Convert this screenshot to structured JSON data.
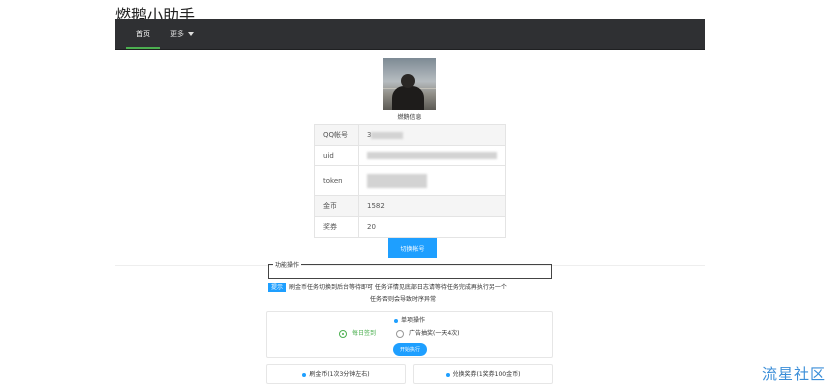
{
  "app": {
    "title": "燃鹅小助手"
  },
  "nav": {
    "home": "首页",
    "more": "更多"
  },
  "profile": {
    "caption": "燃鹅信息"
  },
  "account_table": {
    "rows": [
      {
        "label": "QQ帐号",
        "value": "3"
      },
      {
        "label": "uid",
        "value": ""
      },
      {
        "label": "token",
        "value": ""
      },
      {
        "label": "金币",
        "value": "1582"
      },
      {
        "label": "奖券",
        "value": "20"
      }
    ]
  },
  "switch_button": "切换帐号",
  "section": {
    "legend": "功能操作"
  },
  "tip": {
    "badge": "提示",
    "line1": "刷金币任务切换到后台等待即可 任务详情见底部日志请等待任务完成再执行另一个",
    "line2": "任务否则会导致时序异常"
  },
  "single_ops": {
    "title": "单项操作",
    "options": [
      "每日签到",
      "广告抽奖(一天4次)"
    ],
    "selected": "每日签到",
    "run_button": "开始执行"
  },
  "bottom_panels": {
    "left_title": "刷金币(1次3分钟左右)",
    "right_title": "兑换奖券(1奖券100金币)"
  },
  "watermark": "流星社区"
}
